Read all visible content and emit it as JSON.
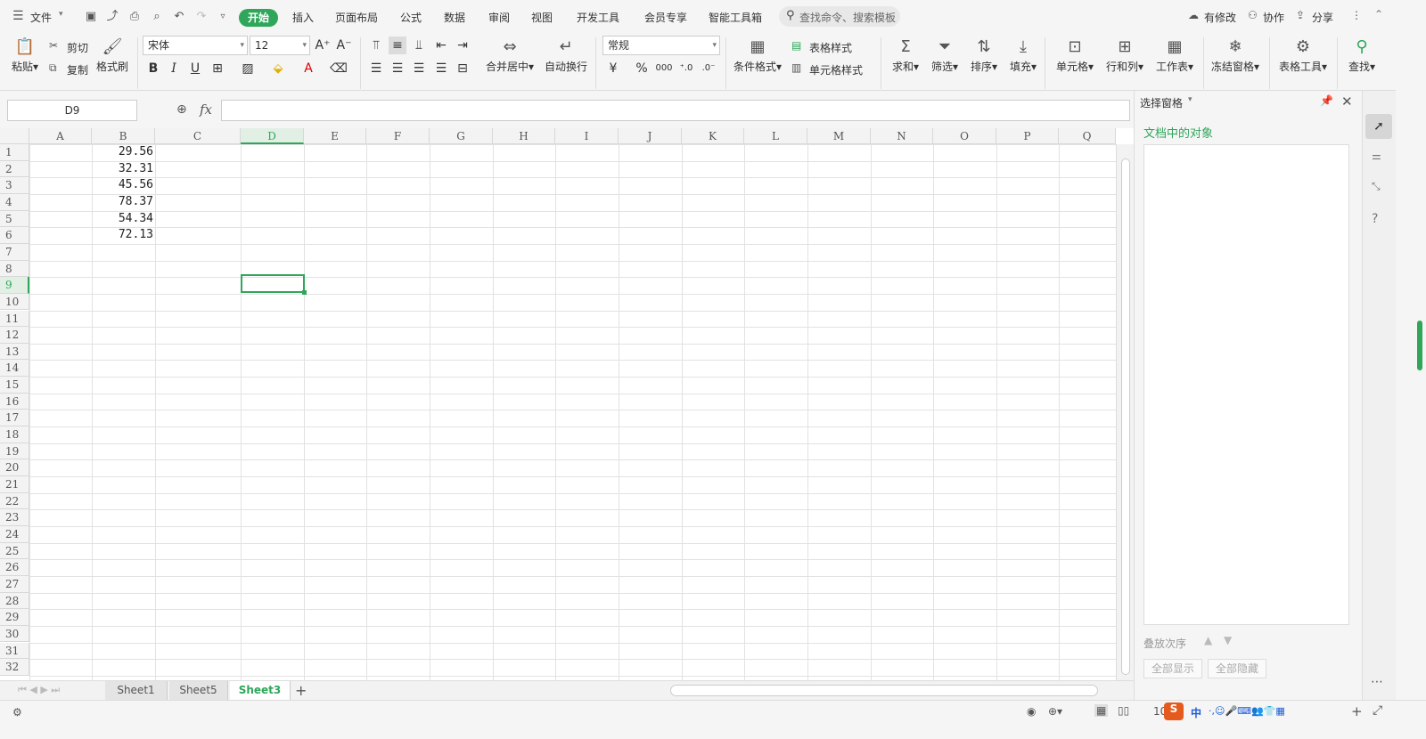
{
  "menu": {
    "file_label": "文件"
  },
  "tabs": [
    {
      "label": "开始",
      "active": true
    },
    {
      "label": "插入"
    },
    {
      "label": "页面布局"
    },
    {
      "label": "公式"
    },
    {
      "label": "数据"
    },
    {
      "label": "审阅"
    },
    {
      "label": "视图"
    },
    {
      "label": "开发工具"
    },
    {
      "label": "会员专享"
    },
    {
      "label": "智能工具箱"
    }
  ],
  "search": {
    "placeholder": "查找命令、搜索模板"
  },
  "top_right": {
    "modified": "有修改",
    "collab": "协作",
    "share": "分享"
  },
  "ribbon": {
    "paste": "粘贴",
    "cut": "剪切",
    "copy": "复制",
    "format_painter": "格式刷",
    "font_name": "宋体",
    "font_size": "12",
    "merge_center": "合并居中",
    "wrap_text": "自动换行",
    "number_format": "常规",
    "cond_format": "条件格式",
    "table_style": "表格样式",
    "cell_style": "单元格样式",
    "sum": "求和",
    "filter": "筛选",
    "sort": "排序",
    "fill": "填充",
    "cells": "单元格",
    "rows_cols": "行和列",
    "worksheet": "工作表",
    "freeze": "冻结窗格",
    "table_tools": "表格工具",
    "find": "查找"
  },
  "formula_bar": {
    "name_box": "D9",
    "fx": "fx",
    "formula": ""
  },
  "columns": [
    "A",
    "B",
    "C",
    "D",
    "E",
    "F",
    "G",
    "H",
    "I",
    "J",
    "K",
    "L",
    "M",
    "N",
    "O",
    "P",
    "Q"
  ],
  "active_column": "D",
  "active_row": "9",
  "rows": [
    "1",
    "2",
    "3",
    "4",
    "5",
    "6",
    "7",
    "8",
    "9",
    "10",
    "11",
    "12",
    "13",
    "14",
    "15",
    "16",
    "17",
    "18",
    "19",
    "20",
    "21",
    "22",
    "23",
    "24",
    "25",
    "26",
    "27",
    "28",
    "29",
    "30",
    "31",
    "32"
  ],
  "cells_B": [
    "29.56",
    "32.31",
    "45.56",
    "78.37",
    "54.34",
    "72.13"
  ],
  "sheet_tabs": [
    {
      "label": "Sheet1"
    },
    {
      "label": "Sheet5"
    },
    {
      "label": "Sheet3",
      "active": true
    }
  ],
  "panel": {
    "title": "选择窗格",
    "objects_label": "文档中的对象",
    "sort_label": "叠放次序",
    "show_all": "全部显示",
    "hide_all": "全部隐藏"
  },
  "status": {
    "zoom": "10",
    "ime_label": "中"
  },
  "colors": {
    "accent": "#2fa65a",
    "grid": "#e2e2e2"
  }
}
